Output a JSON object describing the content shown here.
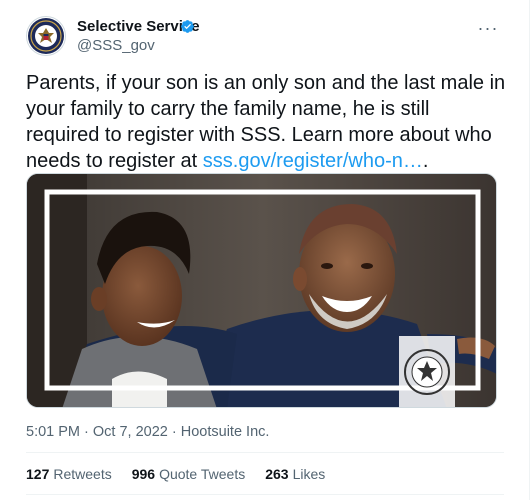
{
  "author": {
    "display_name": "Selective Service",
    "handle": "@SSS_gov",
    "verified": true,
    "avatar_icon": "selective-service-seal"
  },
  "menu": {
    "more_label": "···"
  },
  "tweet": {
    "text_before_link": "Parents, if your son is an only son and the last male in your family to carry the family name, he is still required to register with SSS. Learn more about who needs to register at ",
    "link_text": "sss.gov/register/who-n…",
    "text_after_link": "."
  },
  "media": {
    "description_icon": "photo-father-and-son",
    "watermark_icon": "selective-service-seal"
  },
  "meta": {
    "time": "5:01 PM",
    "separator": " · ",
    "date": "Oct 7, 2022",
    "source": "Hootsuite Inc."
  },
  "stats": {
    "retweets": {
      "count": "127",
      "label": "Retweets"
    },
    "quote_tweets": {
      "count": "996",
      "label": "Quote Tweets"
    },
    "likes": {
      "count": "263",
      "label": "Likes"
    }
  },
  "colors": {
    "link": "#1d9bf0",
    "secondary_text": "#536471",
    "primary_text": "#0f1419",
    "verified": "#1d9bf0"
  }
}
